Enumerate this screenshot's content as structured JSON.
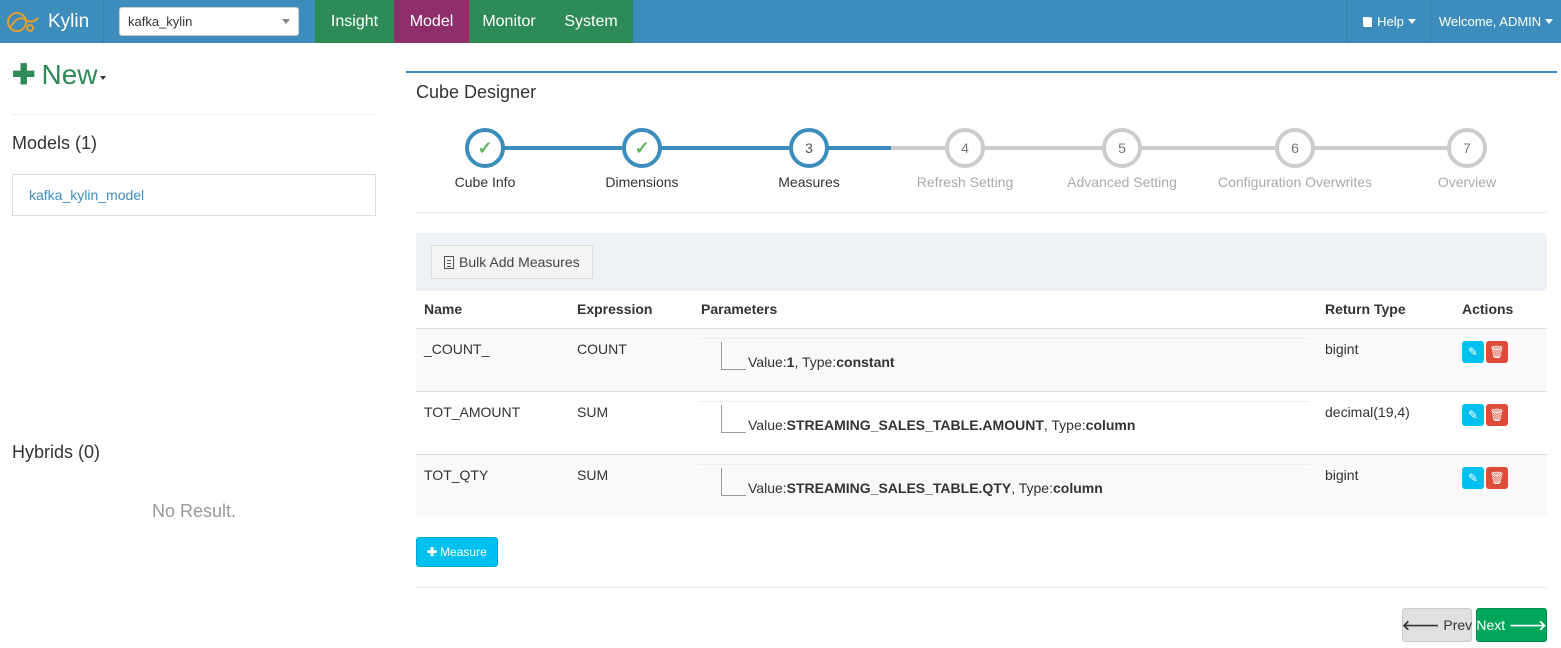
{
  "navbar": {
    "brand": "Kylin",
    "project": "kafka_kylin",
    "tabs": [
      "Insight",
      "Model",
      "Monitor",
      "System"
    ],
    "active_tab": "Model",
    "help": "Help",
    "welcome": "Welcome, ADMIN"
  },
  "sidebar": {
    "new_label": "New",
    "models_title": "Models (1)",
    "models": [
      "kafka_kylin_model"
    ],
    "hybrids_title": "Hybrids (0)",
    "no_result": "No Result."
  },
  "designer": {
    "title": "Cube Designer",
    "steps": [
      {
        "num": "1",
        "label": "Cube Info",
        "state": "done"
      },
      {
        "num": "2",
        "label": "Dimensions",
        "state": "done"
      },
      {
        "num": "3",
        "label": "Measures",
        "state": "active"
      },
      {
        "num": "4",
        "label": "Refresh Setting",
        "state": "todo"
      },
      {
        "num": "5",
        "label": "Advanced Setting",
        "state": "todo"
      },
      {
        "num": "6",
        "label": "Configuration Overwrites",
        "state": "todo"
      },
      {
        "num": "7",
        "label": "Overview",
        "state": "todo"
      }
    ],
    "bulk_add": "Bulk Add Measures",
    "columns": [
      "Name",
      "Expression",
      "Parameters",
      "Return Type",
      "Actions"
    ],
    "rows": [
      {
        "name": "_COUNT_",
        "expression": "COUNT",
        "value": "1",
        "type": "constant",
        "return_type": "bigint"
      },
      {
        "name": "TOT_AMOUNT",
        "expression": "SUM",
        "value": "STREAMING_SALES_TABLE.AMOUNT",
        "type": "column",
        "return_type": "decimal(19,4)"
      },
      {
        "name": "TOT_QTY",
        "expression": "SUM",
        "value": "STREAMING_SALES_TABLE.QTY",
        "type": "column",
        "return_type": "bigint"
      }
    ],
    "value_prefix": "Value:",
    "type_prefix": ", Type:",
    "add_measure": "Measure",
    "prev": "Prev",
    "next": "Next"
  },
  "colors": {
    "navbar": "#3c8dbc",
    "nav_tab": "#2e8b57",
    "nav_active": "#8e2e6a",
    "step_done": "#3c8dbc",
    "check": "#5cb85c",
    "next_button": "#00a65a",
    "add_button": "#00c0ef",
    "delete_button": "#dd4b39"
  }
}
